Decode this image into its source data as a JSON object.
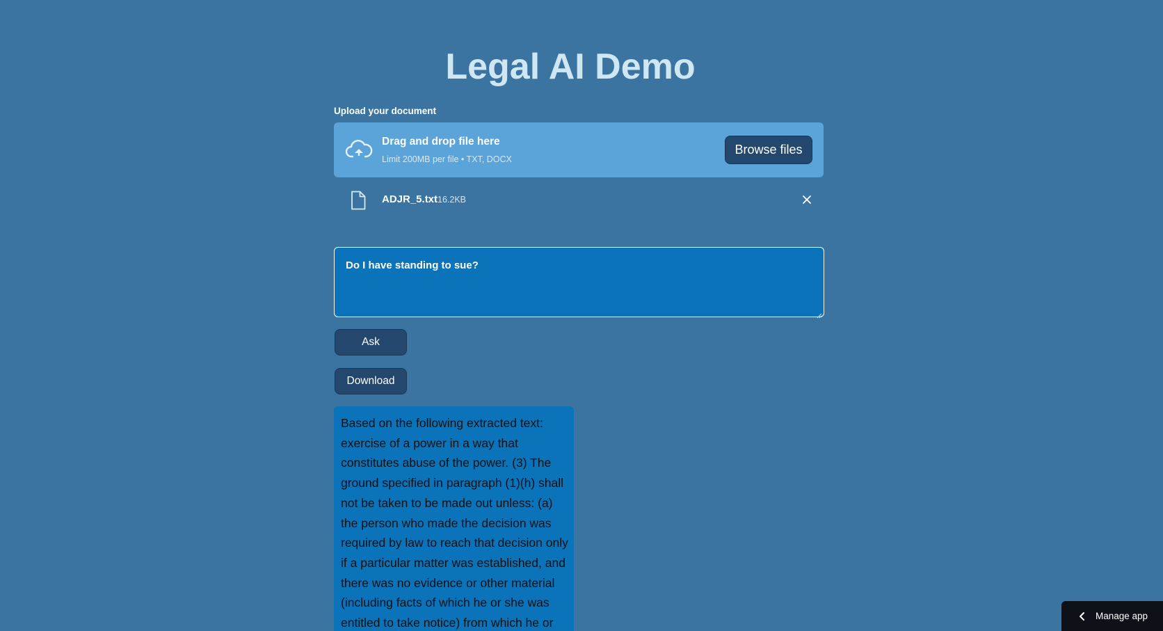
{
  "page": {
    "title": "Legal AI Demo"
  },
  "uploader": {
    "label": "Upload your document",
    "drop_text": "Drag and drop file here",
    "limit_text": "Limit 200MB per file • TXT, DOCX",
    "browse_label": "Browse files",
    "icon": "cloud-upload-icon"
  },
  "uploaded_file": {
    "name": "ADJR_5.txt",
    "size": "16.2KB",
    "icon": "file-icon",
    "remove_icon": "close-icon"
  },
  "question": {
    "value": "Do I have standing to sue?"
  },
  "buttons": {
    "ask_label": "Ask",
    "download_label": "Download"
  },
  "answer": {
    "text": "Based on the following extracted text: exercise of a power in a way that constitutes abuse of the power. (3) The ground specified in paragraph (1)(h) shall not be taken to be made out unless: (a) the person who made the decision was required by law to reach that decision only if a particular matter was established, and there was no evidence or other material (including facts of which he or she was entitled to take notice) from which he or"
  },
  "footer": {
    "manage_label": "Manage app",
    "icon": "chevron-left-icon"
  },
  "colors": {
    "background": "#3b74a0",
    "title": "#cfe6f3",
    "dropzone": "#5ba4d9",
    "button": "#24476d",
    "input": "#0a73b9",
    "manage_bar": "#0e1117"
  }
}
